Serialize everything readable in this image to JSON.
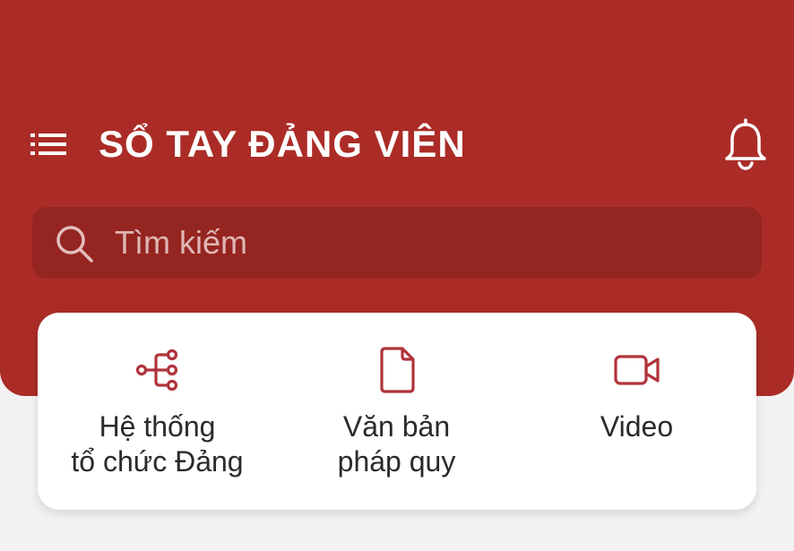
{
  "header": {
    "title": "SỔ TAY ĐẢNG VIÊN",
    "menu_icon": "list-menu-icon",
    "notification_icon": "bell-icon",
    "background_color": "#ab2c26"
  },
  "search": {
    "placeholder": "Tìm kiếm",
    "value": "",
    "icon": "search-icon",
    "background_color": "#952521"
  },
  "quick_actions": [
    {
      "label_line1": "Hệ thống",
      "label_line2": "tổ chức Đảng",
      "icon": "org-chart-icon"
    },
    {
      "label_line1": "Văn bản",
      "label_line2": "pháp quy",
      "icon": "document-icon"
    },
    {
      "label_line1": "Video",
      "label_line2": "",
      "icon": "video-camera-icon"
    }
  ],
  "colors": {
    "accent": "#b0333b",
    "page_background": "#f2f2f2",
    "card_background": "#ffffff"
  }
}
